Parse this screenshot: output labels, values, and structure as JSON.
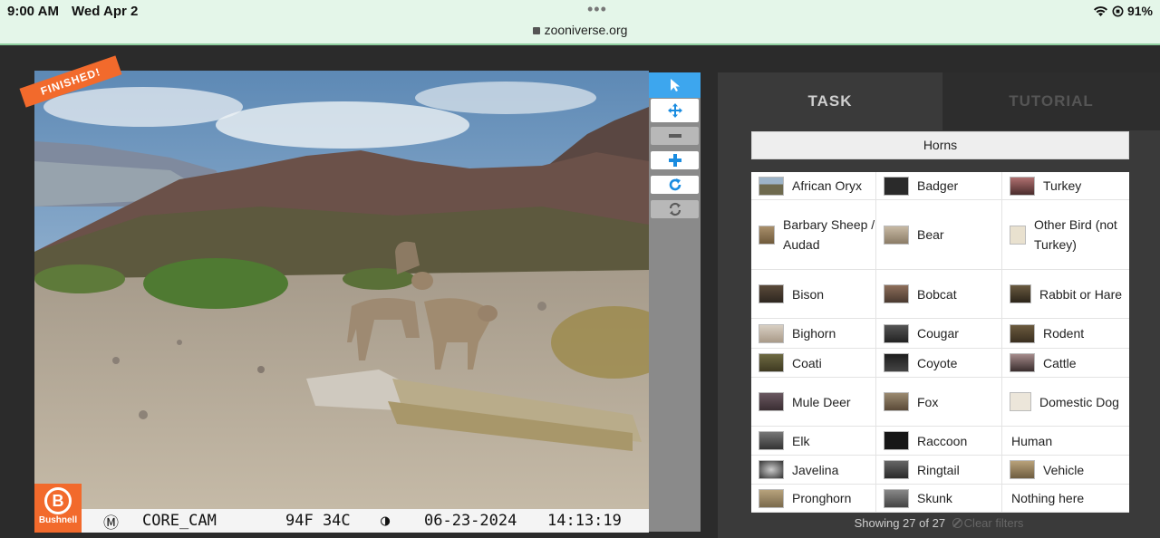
{
  "status": {
    "time": "9:00 AM",
    "date": "Wed Apr 2",
    "url": "zooniverse.org",
    "battery": "91%"
  },
  "subject": {
    "badge": "FINISHED!",
    "brand": "Bushnell",
    "camera": {
      "mode": "M",
      "name": "CORE_CAM",
      "temp": "94F 34C",
      "date": "06-23-2024",
      "time": "14:13:19"
    }
  },
  "toolbar": {
    "icons": [
      "pointer-icon",
      "move-icon",
      "zoom-out-icon",
      "zoom-in-icon",
      "rotate-icon",
      "reset-icon"
    ]
  },
  "panel": {
    "tabs": [
      "TASK",
      "TUTORIAL"
    ],
    "active_tab": "TASK",
    "filter_label": "Horns",
    "footer": "Showing 27 of 27",
    "clear_filters": "Clear filters",
    "species": [
      "African Oryx",
      "Badger",
      "Turkey",
      "Barbary Sheep / Audad",
      "Bear",
      "Other Bird (not Turkey)",
      "Bison",
      "Bobcat",
      "Rabbit or Hare",
      "Bighorn",
      "Cougar",
      "Rodent",
      "Coati",
      "Coyote",
      "Cattle",
      "Mule Deer",
      "Fox",
      "Domestic Dog",
      "Elk",
      "Raccoon",
      "Human",
      "Javelina",
      "Ringtail",
      "Vehicle",
      "Pronghorn",
      "Skunk",
      "Nothing here"
    ]
  }
}
